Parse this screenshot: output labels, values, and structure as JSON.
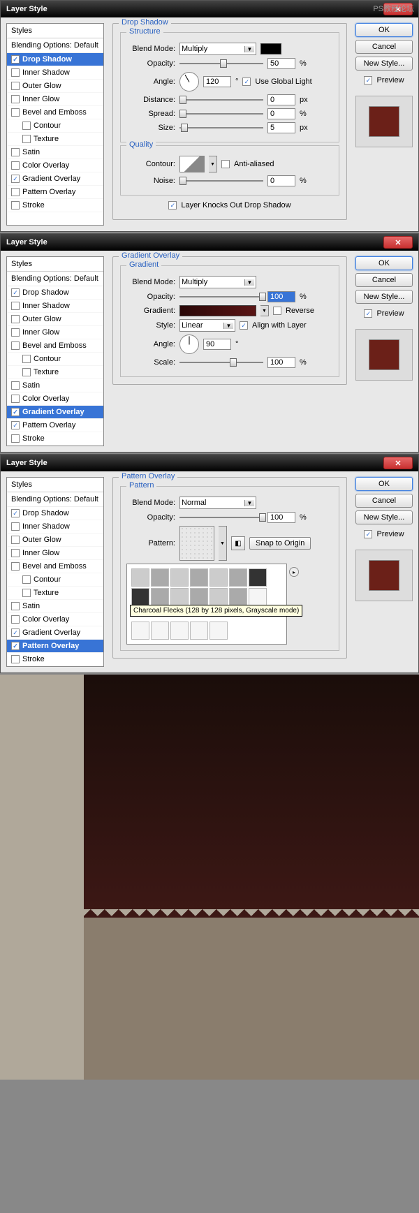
{
  "watermark": "PS教程论坛",
  "dialogs": [
    {
      "title": "Layer Style",
      "section": "Drop Shadow",
      "selected_style": "Drop Shadow",
      "styles_header": "Styles",
      "blending_label": "Blending Options: Default",
      "styles": [
        {
          "label": "Drop Shadow",
          "checked": true
        },
        {
          "label": "Inner Shadow",
          "checked": false
        },
        {
          "label": "Outer Glow",
          "checked": false
        },
        {
          "label": "Inner Glow",
          "checked": false
        },
        {
          "label": "Bevel and Emboss",
          "checked": false
        },
        {
          "label": "Contour",
          "checked": false,
          "indent": true
        },
        {
          "label": "Texture",
          "checked": false,
          "indent": true
        },
        {
          "label": "Satin",
          "checked": false
        },
        {
          "label": "Color Overlay",
          "checked": false
        },
        {
          "label": "Gradient Overlay",
          "checked": true
        },
        {
          "label": "Pattern Overlay",
          "checked": false
        },
        {
          "label": "Stroke",
          "checked": false
        }
      ],
      "structure_label": "Structure",
      "blend_mode_label": "Blend Mode:",
      "blend_mode_value": "Multiply",
      "opacity_label": "Opacity:",
      "opacity_value": "50",
      "angle_label": "Angle:",
      "angle_value": "120",
      "use_global_label": "Use Global Light",
      "distance_label": "Distance:",
      "distance_value": "0",
      "spread_label": "Spread:",
      "spread_value": "0",
      "size_label": "Size:",
      "size_value": "5",
      "quality_label": "Quality",
      "contour_label": "Contour:",
      "anti_aliased_label": "Anti-aliased",
      "noise_label": "Noise:",
      "noise_value": "0",
      "knockout_label": "Layer Knocks Out Drop Shadow",
      "percent": "%",
      "px": "px",
      "deg": "°",
      "buttons": {
        "ok": "OK",
        "cancel": "Cancel",
        "new_style": "New Style...",
        "preview": "Preview"
      }
    },
    {
      "title": "Layer Style",
      "section": "Gradient Overlay",
      "selected_style": "Gradient Overlay",
      "styles_header": "Styles",
      "blending_label": "Blending Options: Default",
      "styles": [
        {
          "label": "Drop Shadow",
          "checked": true
        },
        {
          "label": "Inner Shadow",
          "checked": false
        },
        {
          "label": "Outer Glow",
          "checked": false
        },
        {
          "label": "Inner Glow",
          "checked": false
        },
        {
          "label": "Bevel and Emboss",
          "checked": false
        },
        {
          "label": "Contour",
          "checked": false,
          "indent": true
        },
        {
          "label": "Texture",
          "checked": false,
          "indent": true
        },
        {
          "label": "Satin",
          "checked": false
        },
        {
          "label": "Color Overlay",
          "checked": false
        },
        {
          "label": "Gradient Overlay",
          "checked": true
        },
        {
          "label": "Pattern Overlay",
          "checked": true
        },
        {
          "label": "Stroke",
          "checked": false
        }
      ],
      "gradient_label": "Gradient",
      "blend_mode_label": "Blend Mode:",
      "blend_mode_value": "Multiply",
      "opacity_label": "Opacity:",
      "opacity_value": "100",
      "gradient_field_label": "Gradient:",
      "reverse_label": "Reverse",
      "style_label": "Style:",
      "style_value": "Linear",
      "align_label": "Align with Layer",
      "angle_label": "Angle:",
      "angle_value": "90",
      "scale_label": "Scale:",
      "scale_value": "100",
      "percent": "%",
      "deg": "°",
      "buttons": {
        "ok": "OK",
        "cancel": "Cancel",
        "new_style": "New Style...",
        "preview": "Preview"
      }
    },
    {
      "title": "Layer Style",
      "section": "Pattern Overlay",
      "selected_style": "Pattern Overlay",
      "styles_header": "Styles",
      "blending_label": "Blending Options: Default",
      "styles": [
        {
          "label": "Drop Shadow",
          "checked": true
        },
        {
          "label": "Inner Shadow",
          "checked": false
        },
        {
          "label": "Outer Glow",
          "checked": false
        },
        {
          "label": "Inner Glow",
          "checked": false
        },
        {
          "label": "Bevel and Emboss",
          "checked": false
        },
        {
          "label": "Contour",
          "checked": false,
          "indent": true
        },
        {
          "label": "Texture",
          "checked": false,
          "indent": true
        },
        {
          "label": "Satin",
          "checked": false
        },
        {
          "label": "Color Overlay",
          "checked": false
        },
        {
          "label": "Gradient Overlay",
          "checked": true
        },
        {
          "label": "Pattern Overlay",
          "checked": true
        },
        {
          "label": "Stroke",
          "checked": false
        }
      ],
      "pattern_label": "Pattern",
      "blend_mode_label": "Blend Mode:",
      "blend_mode_value": "Normal",
      "opacity_label": "Opacity:",
      "opacity_value": "100",
      "pattern_field_label": "Pattern:",
      "snap_label": "Snap to Origin",
      "tooltip": "Charcoal Flecks (128 by 128 pixels, Grayscale mode)",
      "percent": "%",
      "buttons": {
        "ok": "OK",
        "cancel": "Cancel",
        "new_style": "New Style...",
        "preview": "Preview"
      }
    }
  ]
}
